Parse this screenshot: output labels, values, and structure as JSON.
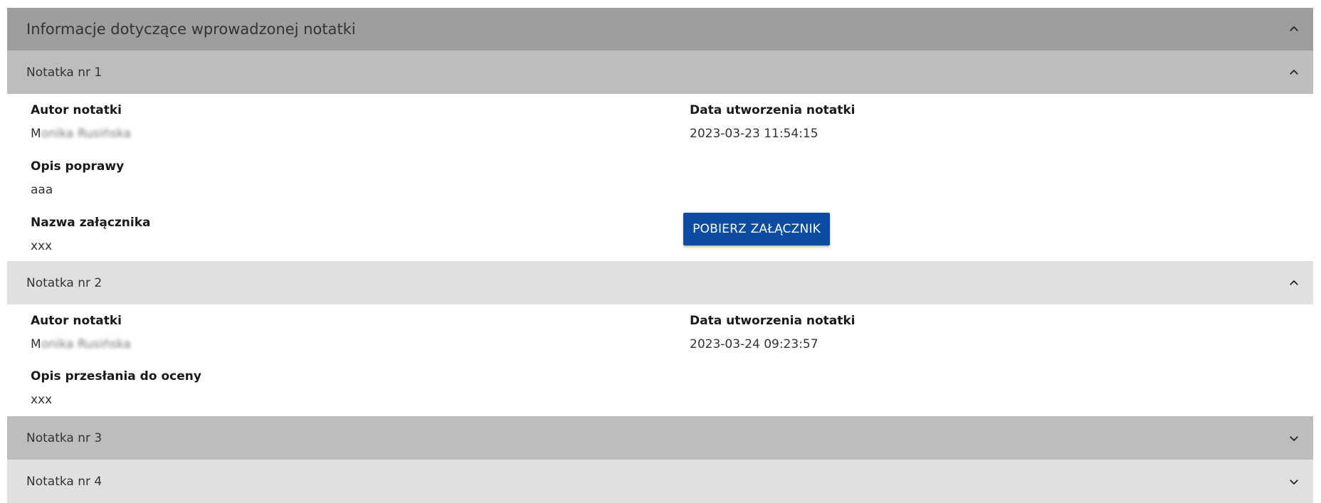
{
  "section": {
    "title": "Informacje dotyczące wprowadzonej notatki",
    "toggle_icon": "chevron-up-icon"
  },
  "notes": [
    {
      "title": "Notatka nr 1",
      "expanded": true,
      "author_label": "Autor notatki",
      "author_value_initial": "M",
      "author_value_blurred": "onika Rusińska",
      "date_label": "Data utworzenia notatki",
      "date_value": "2023-03-23 11:54:15",
      "description_label": "Opis poprawy",
      "description_value": "aaa",
      "attachment_label": "Nazwa załącznika",
      "attachment_value": "xxx",
      "download_button": "POBIERZ ZAŁĄCZNIK"
    },
    {
      "title": "Notatka nr 2",
      "expanded": true,
      "author_label": "Autor notatki",
      "author_value_initial": "M",
      "author_value_blurred": "onika Rusińska",
      "date_label": "Data utworzenia notatki",
      "date_value": "2023-03-24 09:23:57",
      "description_label": "Opis przesłania do oceny",
      "description_value": "xxx"
    },
    {
      "title": "Notatka nr 3",
      "expanded": false
    },
    {
      "title": "Notatka nr 4",
      "expanded": false
    }
  ],
  "colors": {
    "header_bg": "#9e9e9e",
    "note1_bg": "#bdbdbd",
    "note2_bg": "#e0e0e0",
    "note3_bg": "#bdbdbd",
    "note4_bg": "#e0e0e0",
    "button_bg": "#0c4ca3"
  }
}
